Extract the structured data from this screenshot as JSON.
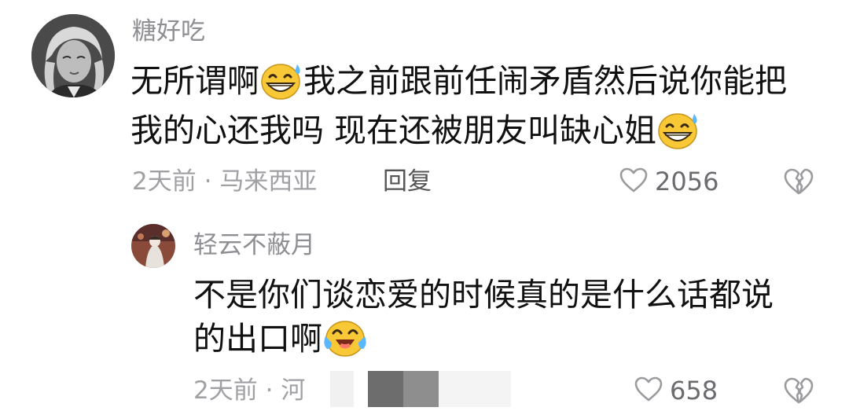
{
  "comment": {
    "username": "糖好吃",
    "text_line1_a": "无所谓啊",
    "text_line1_b": "我之前跟前任闹矛盾然后说你能把",
    "text_line2": "我的心还我吗 现在还被朋友叫缺心姐",
    "emoji_1": "sweat-grin-emoji",
    "emoji_2": "sweat-grin-emoji",
    "time": "2天前",
    "separator": "·",
    "location": "马来西亚",
    "reply_label": "回复",
    "like_icon": "heart-outline-icon",
    "likes": "2056",
    "dislike_icon": "broken-heart-icon"
  },
  "reply": {
    "username": "轻云不蔽月",
    "text_line1": "不是你们谈恋爱的时候真的是什么话都说",
    "text_line2": "的出口啊",
    "emoji_1": "crying-laughing-emoji",
    "time": "2天前",
    "separator": "·",
    "location_partial": "河",
    "like_icon": "heart-outline-icon",
    "likes": "658",
    "dislike_icon": "broken-heart-icon"
  },
  "colors": {
    "username": "#8e8e93",
    "text": "#111111",
    "meta": "#a0a0a5",
    "reply_label": "#555555",
    "emoji_face": "#f9c836"
  }
}
